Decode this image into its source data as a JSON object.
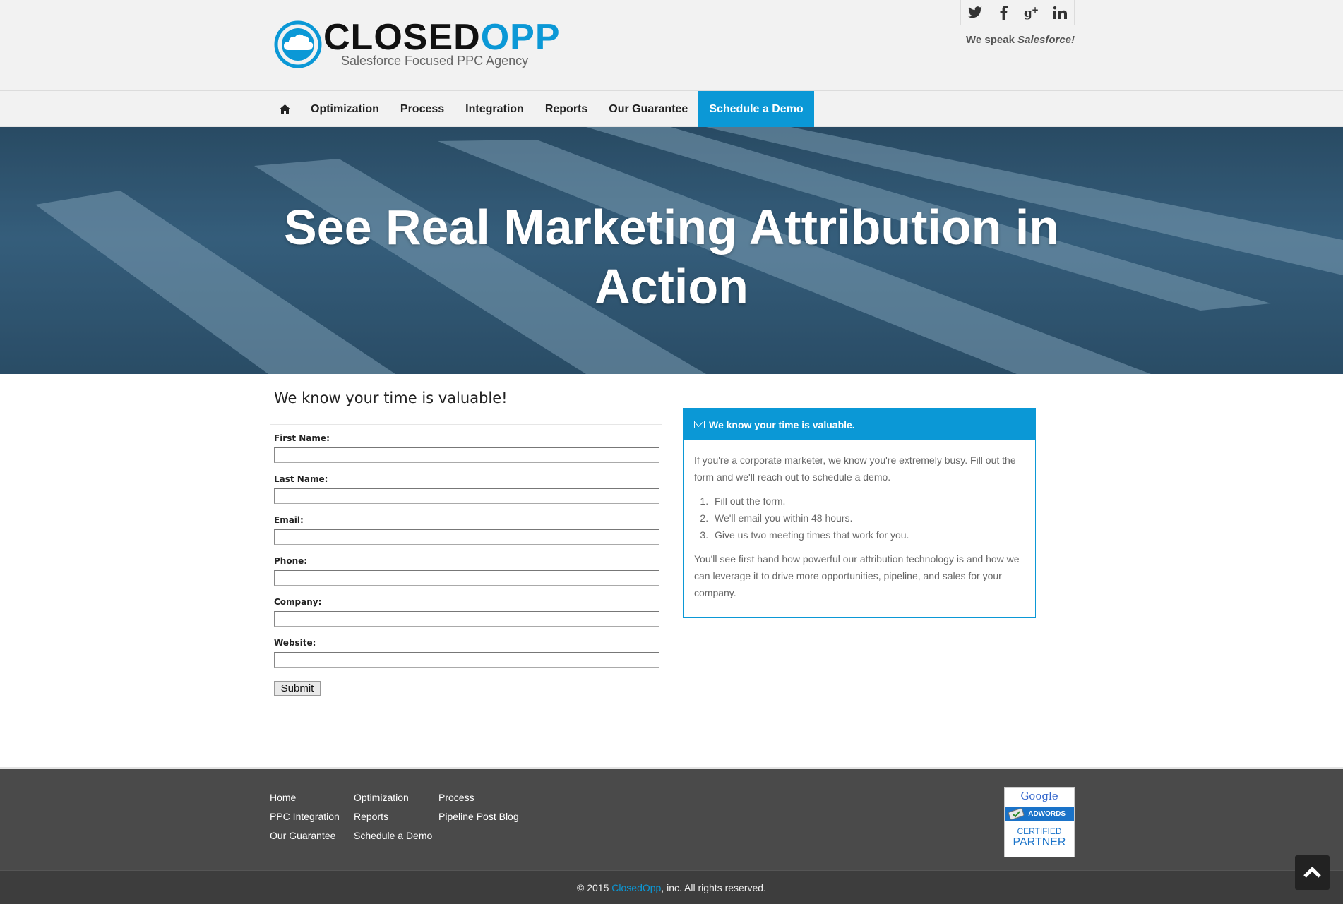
{
  "brand": {
    "name_main": "CLOSED",
    "name_accent": "OPP",
    "tagline": "Salesforce Focused PPC Agency",
    "accent_color": "#0b98d6"
  },
  "header": {
    "social": [
      {
        "icon": "twitter-icon",
        "glyph": "🐦"
      },
      {
        "icon": "facebook-icon",
        "glyph": "f"
      },
      {
        "icon": "google-plus-icon",
        "glyph": "g+"
      },
      {
        "icon": "linkedin-icon",
        "glyph": "in"
      }
    ],
    "speak_prefix": "We speak ",
    "speak_emphasis": "Salesforce!"
  },
  "nav": {
    "home_icon": "home-icon",
    "items": [
      "Optimization",
      "Process",
      "Integration",
      "Reports",
      "Our Guarantee"
    ],
    "cta": "Schedule a Demo"
  },
  "hero": {
    "title": "See Real Marketing Attribution in Action"
  },
  "form": {
    "heading": "We know your time is valuable!",
    "fields": [
      {
        "label": "First Name:",
        "value": ""
      },
      {
        "label": "Last Name:",
        "value": ""
      },
      {
        "label": "Email:",
        "value": ""
      },
      {
        "label": "Phone:",
        "value": ""
      },
      {
        "label": "Company:",
        "value": ""
      },
      {
        "label": "Website:",
        "value": ""
      }
    ],
    "submit": "Submit"
  },
  "panel": {
    "title": "We know your time is valuable.",
    "intro": "If you're a corporate marketer, we know you're extremely busy. Fill out the form and we'll reach out to schedule a demo.",
    "steps": [
      "Fill out the form.",
      "We'll email you within 48 hours.",
      "Give us two meeting times that work for you."
    ],
    "outro": "You'll see first hand how powerful our attribution technology is and how we can leverage it to drive more opportunities, pipeline, and sales for your company."
  },
  "footer": {
    "col1": [
      "Home",
      "PPC Integration",
      "Our Guarantee"
    ],
    "col2": [
      "Optimization",
      "Reports",
      "Schedule a Demo"
    ],
    "col3": [
      "Process",
      "Pipeline Post Blog"
    ],
    "badge": {
      "google": "Google",
      "band": "ADWORDS",
      "certified": "CERTIFIED",
      "partner": "PARTNER"
    },
    "copyright_prefix": "© 2015 ",
    "copyright_brand": "ClosedOpp",
    "copyright_suffix": ", inc. All rights reserved."
  }
}
